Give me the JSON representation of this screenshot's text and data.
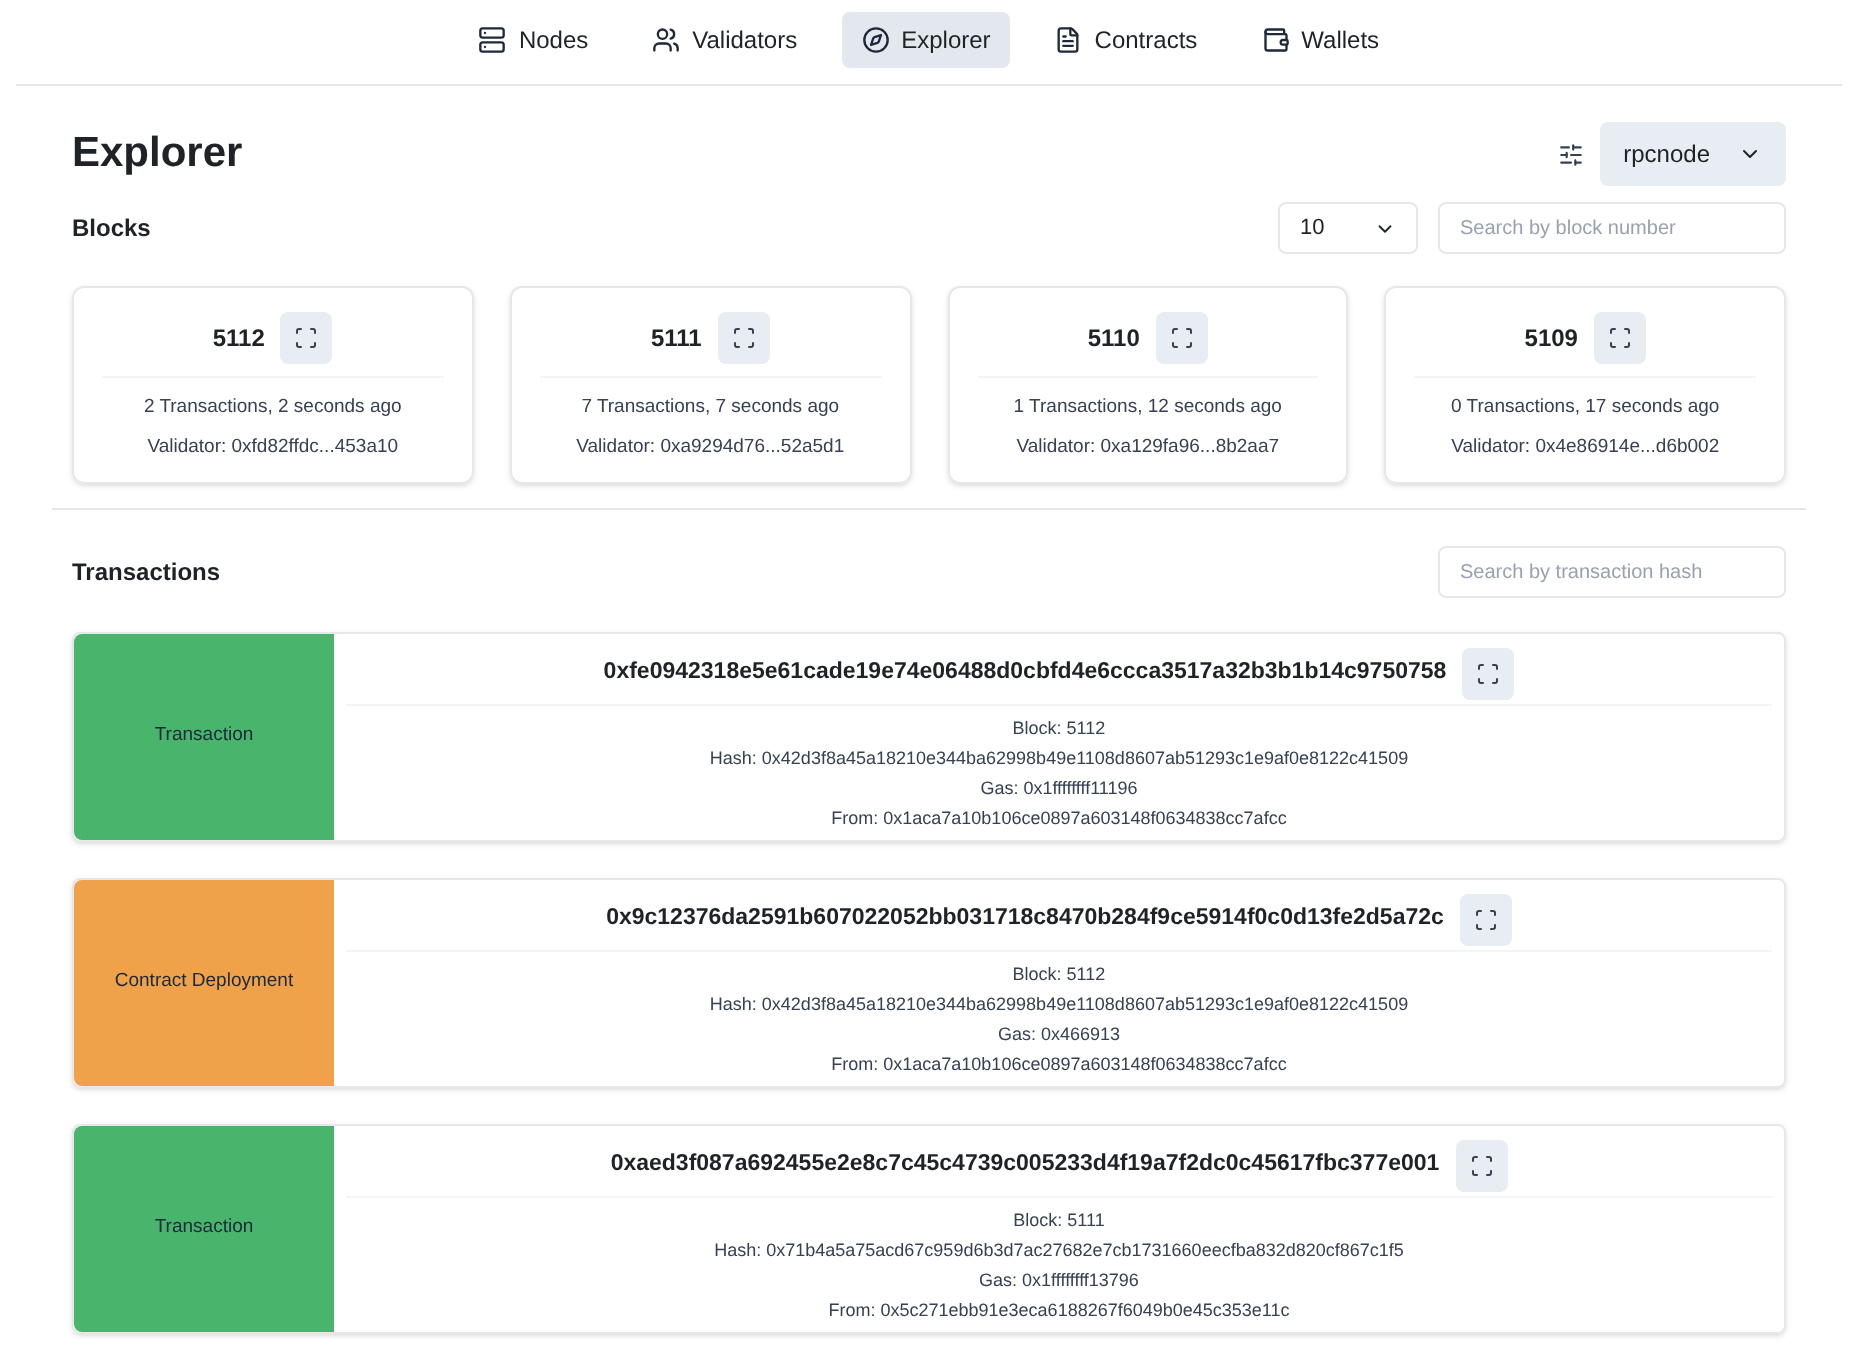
{
  "nav": [
    {
      "label": "Nodes",
      "kind": "server",
      "selected": false
    },
    {
      "label": "Validators",
      "kind": "users",
      "selected": false
    },
    {
      "label": "Explorer",
      "kind": "compass",
      "selected": true
    },
    {
      "label": "Contracts",
      "kind": "file",
      "selected": false
    },
    {
      "label": "Wallets",
      "kind": "wallet",
      "selected": false
    }
  ],
  "title": "Explorer",
  "node_select": {
    "value": "rpcnode"
  },
  "blocks": {
    "heading": "Blocks",
    "page_size": "10",
    "search": {
      "placeholder": "Search by block number"
    },
    "items": [
      {
        "number": "5112",
        "summary": "2 Transactions, 2 seconds ago",
        "validator": "Validator: 0xfd82ffdc...453a10"
      },
      {
        "number": "5111",
        "summary": "7 Transactions, 7 seconds ago",
        "validator": "Validator: 0xa9294d76...52a5d1"
      },
      {
        "number": "5110",
        "summary": "1 Transactions, 12 seconds ago",
        "validator": "Validator: 0xa129fa96...8b2aa7"
      },
      {
        "number": "5109",
        "summary": "0 Transactions, 17 seconds ago",
        "validator": "Validator: 0x4e86914e...d6b002"
      }
    ]
  },
  "transactions": {
    "heading": "Transactions",
    "search": {
      "placeholder": "Search by transaction hash"
    },
    "items": [
      {
        "kind": "transaction",
        "label": "Transaction",
        "hash": "0xfe0942318e5e61cade19e74e06488d0cbfd4e6ccca3517a32b3b1b14c9750758",
        "lines": [
          "Block: 5112",
          "Hash: 0x42d3f8a45a18210e344ba62998b49e1108d8607ab51293c1e9af0e8122c41509",
          "Gas: 0x1ffffffff11196",
          "From: 0x1aca7a10b106ce0897a603148f0634838cc7afcc"
        ]
      },
      {
        "kind": "deployment",
        "label": "Contract Deployment",
        "hash": "0x9c12376da2591b607022052bb031718c8470b284f9ce5914f0c0d13fe2d5a72c",
        "lines": [
          "Block: 5112",
          "Hash: 0x42d3f8a45a18210e344ba62998b49e1108d8607ab51293c1e9af0e8122c41509",
          "Gas: 0x466913",
          "From: 0x1aca7a10b106ce0897a603148f0634838cc7afcc"
        ]
      },
      {
        "kind": "transaction",
        "label": "Transaction",
        "hash": "0xaed3f087a692455e2e8c7c45c4739c005233d4f19a7f2dc0c45617fbc377e001",
        "lines": [
          "Block: 5111",
          "Hash: 0x71b4a5a75acd67c959d6b3d7ac27682e7cb1731660eecfba832d820cf867c1f5",
          "Gas: 0x1ffffffff13796",
          "From: 0x5c271ebb91e3eca6188267f6049b0e45c353e11c"
        ]
      }
    ]
  }
}
